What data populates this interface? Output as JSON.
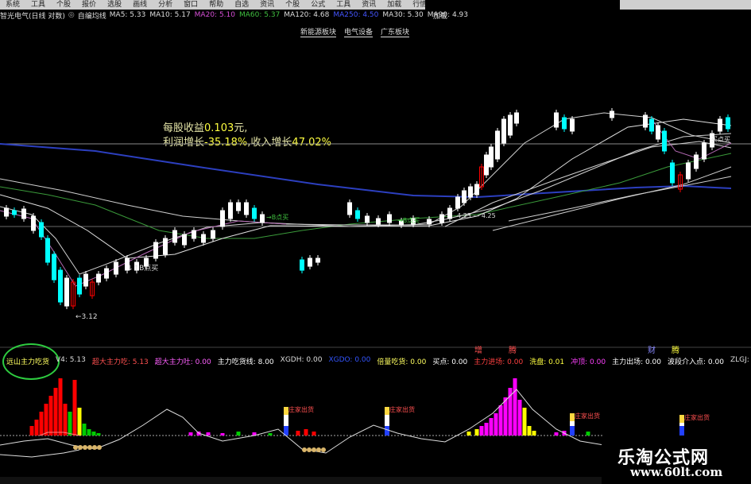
{
  "menu": {
    "items": [
      "系统",
      "工具",
      "个股",
      "报价",
      "选股",
      "画线",
      "分析",
      "窗口",
      "帮助",
      "自选",
      "资讯",
      "个股",
      "公式",
      "工具",
      "资讯",
      "加载",
      "行情",
      "窗口"
    ]
  },
  "header": {
    "title": "智光电气(日线 对数)",
    "indicator": "自编均线",
    "ma": [
      {
        "label": "MA5: 5.33",
        "color": "#dddddd"
      },
      {
        "label": "MA10: 5.17",
        "color": "#dddddd"
      },
      {
        "label": "MA20: 5.10",
        "color": "#d64fd6"
      },
      {
        "label": "MA60: 5.37",
        "color": "#3fbf3f"
      },
      {
        "label": "MA120: 4.68",
        "color": "#dddddd"
      },
      {
        "label": "MA250: 4.50",
        "color": "#4455ff"
      },
      {
        "label": "MA30: 5.30",
        "color": "#dddddd"
      },
      {
        "label": "MA90: 4.93",
        "color": "#dddddd"
      }
    ],
    "right": "加载"
  },
  "sectors": [
    "新能源板块",
    "电气设备",
    "广东板块"
  ],
  "fundamentals": {
    "line1_prefix": "每股收益",
    "eps": "0.103",
    "line1_suffix": "元,",
    "line2_prefix": "利润增长",
    "profit_growth": "-35.18%",
    "line2_mid": ",收入增长",
    "revenue_growth": "47.02%"
  },
  "price_annotations": {
    "low": "3.12",
    "buy1": "↓↑B点买",
    "buy2": "→B点买",
    "buy3": "→B点买",
    "range": "4.23 — 4.25",
    "buy4": "买点买"
  },
  "sub": {
    "title": "远山主力吃货",
    "fields": [
      {
        "label": "V4: 5.13",
        "color": "#dddddd"
      },
      {
        "label": "超大主力吃: 5.13",
        "color": "#ff5050"
      },
      {
        "label": "超大主力吐: 0.00",
        "color": "#ff60ff"
      },
      {
        "label": "主力吃货线: 8.00",
        "color": "#ffffff"
      },
      {
        "label": "XGDH: 0.00",
        "color": "#dddddd"
      },
      {
        "label": "XGDO: 0.00",
        "color": "#3355ff"
      },
      {
        "label": "倍量吃货: 0.00",
        "color": "#ffff60"
      },
      {
        "label": "买点: 0.00",
        "color": "#ffffff"
      },
      {
        "label": "主力进场: 0.00",
        "color": "#ff4040"
      },
      {
        "label": "洗盘: 0.01",
        "color": "#ffff40"
      },
      {
        "label": "冲顶: 0.00",
        "color": "#ff40ff"
      },
      {
        "label": "主力出场: 0.00",
        "color": "#ffffff"
      },
      {
        "label": "波段介入点: 0.00",
        "color": "#ffffff"
      },
      {
        "label": "ZLGJ: 31.54",
        "color": "#dddddd"
      }
    ],
    "top_labels": [
      {
        "text": "增",
        "color": "#ff5050"
      },
      {
        "text": "腾",
        "color": "#ff5050"
      },
      {
        "text": "财",
        "color": "#8888ff"
      },
      {
        "text": "腾",
        "color": "#ffff40"
      }
    ],
    "exit_label": "庄家出货"
  },
  "watermark": {
    "line1": "乐淘公式网",
    "line2": "www.60lt.com"
  }
}
